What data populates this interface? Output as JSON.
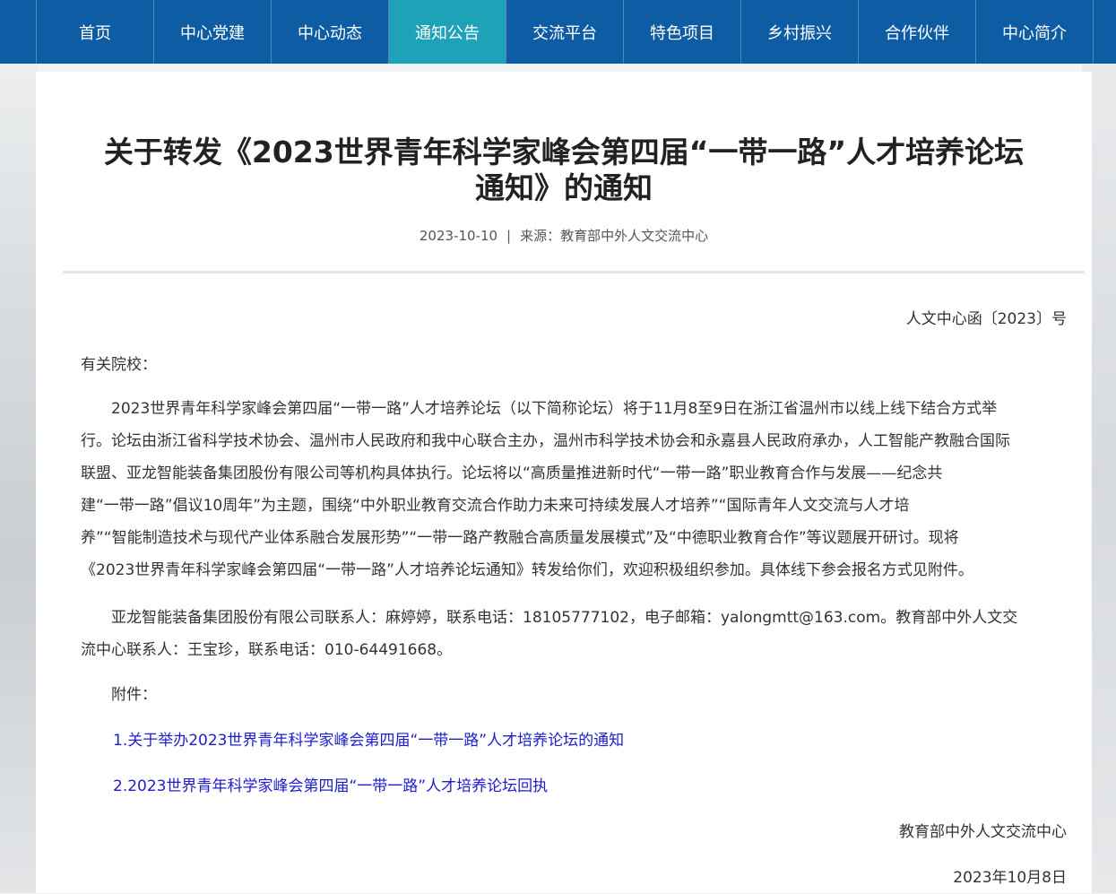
{
  "nav": {
    "items": [
      "首页",
      "中心党建",
      "中心动态",
      "通知公告",
      "交流平台",
      "特色项目",
      "乡村振兴",
      "合作伙伴",
      "中心简介"
    ],
    "active_index": 3,
    "color": "#0e5da4",
    "active_color": "#1da2b7"
  },
  "article": {
    "title_line1": "关于转发《2023世界青年科学家峰会第四届“一带一路”人才培养论坛",
    "title_line2": "通知》的通知",
    "date": "2023-10-10",
    "separator": "|",
    "source": "来源：教育部中外人文交流中心",
    "doc_number": "人文中心函〔2023〕号",
    "salutation": "有关院校：",
    "para1": [
      "　　2023世界青年科学家峰会第四届“一带一路”人才培养论坛（以下简称论坛）将于11月8至9日在浙江省温州市以线上线下结合方式举",
      "行。论坛由浙江省科学技术协会、温州市人民政府和我中心联合主办，温州市科学技术协会和永嘉县人民政府承办，人工智能产教融合国际",
      "联盟、亚龙智能装备集团股份有限公司等机构具体执行。论坛将以“高质量推进新时代“一带一路”职业教育合作与发展——纪念共",
      "建“一带一路”倡议10周年”为主题，围绕“中外职业教育交流合作助力未来可持续发展人才培养”“国际青年人文交流与人才培",
      "养”“智能制造技术与现代产业体系融合发展形势”“一带一路产教融合高质量发展模式”及“中德职业教育合作”等议题展开研讨。现将",
      "《2023世界青年科学家峰会第四届“一带一路”人才培养论坛通知》转发给你们，欢迎积极组织参加。具体线下参会报名方式见附件。"
    ],
    "para2": [
      "　　亚龙智能装备集团股份有限公司联系人：麻婷婷，联系电话：18105777102，电子邮箱：yalongmtt@163.com。教育部中外人文交",
      "流中心联系人：王宝珍，联系电话：010-64491668。"
    ],
    "attachments_label": "　　附件：",
    "attachments": [
      "1.关于举办2023世界青年科学家峰会第四届“一带一路”人才培养论坛的通知",
      "2.2023世界青年科学家峰会第四届“一带一路”人才培养论坛回执"
    ],
    "signature": "教育部中外人文交流中心",
    "sign_date": "2023年10月8日"
  }
}
